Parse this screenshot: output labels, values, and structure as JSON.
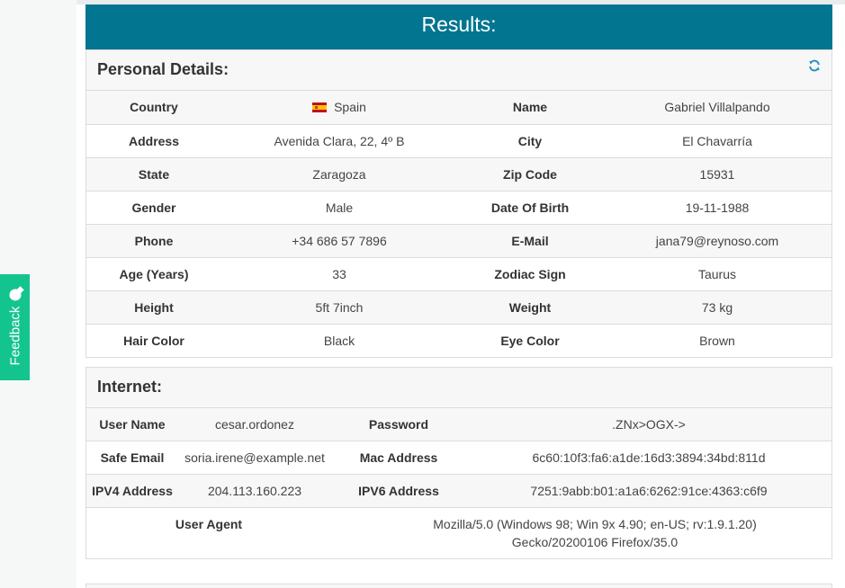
{
  "feedback": {
    "label": "Feedback",
    "icon": "chat-bubble-icon"
  },
  "results": {
    "title": "Results:"
  },
  "personal": {
    "title": "Personal Details:",
    "refresh_icon": "refresh-icon",
    "rows": [
      {
        "l1": "Country",
        "v1": "Spain",
        "l2": "Name",
        "v2": "Gabriel Villalpando"
      },
      {
        "l1": "Address",
        "v1": "Avenida Clara, 22, 4º B",
        "l2": "City",
        "v2": "El Chavarría"
      },
      {
        "l1": "State",
        "v1": "Zaragoza",
        "l2": "Zip Code",
        "v2": "15931"
      },
      {
        "l1": "Gender",
        "v1": "Male",
        "l2": "Date Of Birth",
        "v2": "19-11-1988"
      },
      {
        "l1": "Phone",
        "v1": "+34 686 57 7896",
        "l2": "E-Mail",
        "v2": "jana79@reynoso.com"
      },
      {
        "l1": "Age (Years)",
        "v1": "33",
        "l2": "Zodiac Sign",
        "v2": "Taurus"
      },
      {
        "l1": "Height",
        "v1": "5ft 7inch",
        "l2": "Weight",
        "v2": "73 kg"
      },
      {
        "l1": "Hair Color",
        "v1": "Black",
        "l2": "Eye Color",
        "v2": "Brown"
      }
    ]
  },
  "internet": {
    "title": "Internet:",
    "rows": [
      {
        "l1": "User Name",
        "v1": "cesar.ordonez",
        "l2": "Password",
        "v2": ".ZNx>OGX->"
      },
      {
        "l1": "Safe Email",
        "v1": "soria.irene@example.net",
        "l2": "Mac Address",
        "v2": "6c60:10f3:fa6:a1de:16d3:3894:34bd:811d"
      },
      {
        "l1": "IPV4 Address",
        "v1": "204.113.160.223",
        "l2": "IPV6 Address",
        "v2": "7251:9abb:b01:a1a6:6262:91ce:4363:c6f9"
      }
    ],
    "user_agent": {
      "label": "User Agent",
      "value": "Mozilla/5.0 (Windows 98; Win 9x 4.90; en-US; rv:1.9.1.20) Gecko/20200106 Firefox/35.0"
    }
  }
}
